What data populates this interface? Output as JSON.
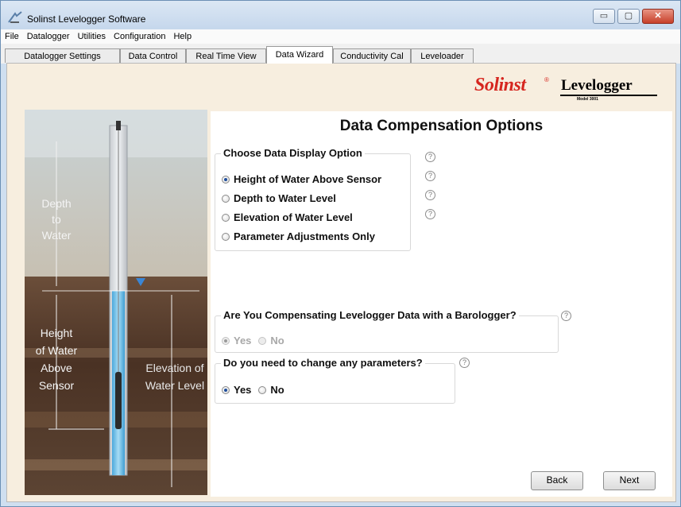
{
  "window": {
    "title": "Solinst Levelogger Software",
    "minimize": "▭",
    "maximize": "▢",
    "close": "✕"
  },
  "menu": [
    "File",
    "Datalogger",
    "Utilities",
    "Configuration",
    "Help"
  ],
  "tabs": [
    {
      "label": "Datalogger Settings"
    },
    {
      "label": "Data Control"
    },
    {
      "label": "Real Time View"
    },
    {
      "label": "Data Wizard"
    },
    {
      "label": "Conductivity Cal"
    },
    {
      "label": "Leveloader"
    }
  ],
  "branding": {
    "solinst": "Solinst",
    "reg": "®",
    "levelogger": "Levelogger",
    "model": "Model 3001"
  },
  "illustration": {
    "depth": [
      "Depth",
      "to",
      "Water"
    ],
    "height": [
      "Height",
      "of Water",
      "Above",
      "Sensor"
    ],
    "elevation": [
      "Elevation of",
      "Water Level"
    ]
  },
  "page": {
    "title": "Data Compensation Options",
    "display_option": {
      "legend": "Choose Data Display Option",
      "options": [
        "Height of Water Above Sensor",
        "Depth to Water Level",
        "Elevation of Water Level",
        "Parameter Adjustments Only"
      ]
    },
    "barologger": {
      "legend": "Are You Compensating Levelogger Data with a Barologger?",
      "yes": "Yes",
      "no": "No"
    },
    "parameters": {
      "legend": "Do you need to change any parameters?",
      "yes": "Yes",
      "no": "No"
    },
    "help": "?",
    "back": "Back",
    "next": "Next"
  },
  "colors": {
    "water": "#6fc3e9",
    "marker": "#3a86d6",
    "brand_red": "#d6261f"
  }
}
